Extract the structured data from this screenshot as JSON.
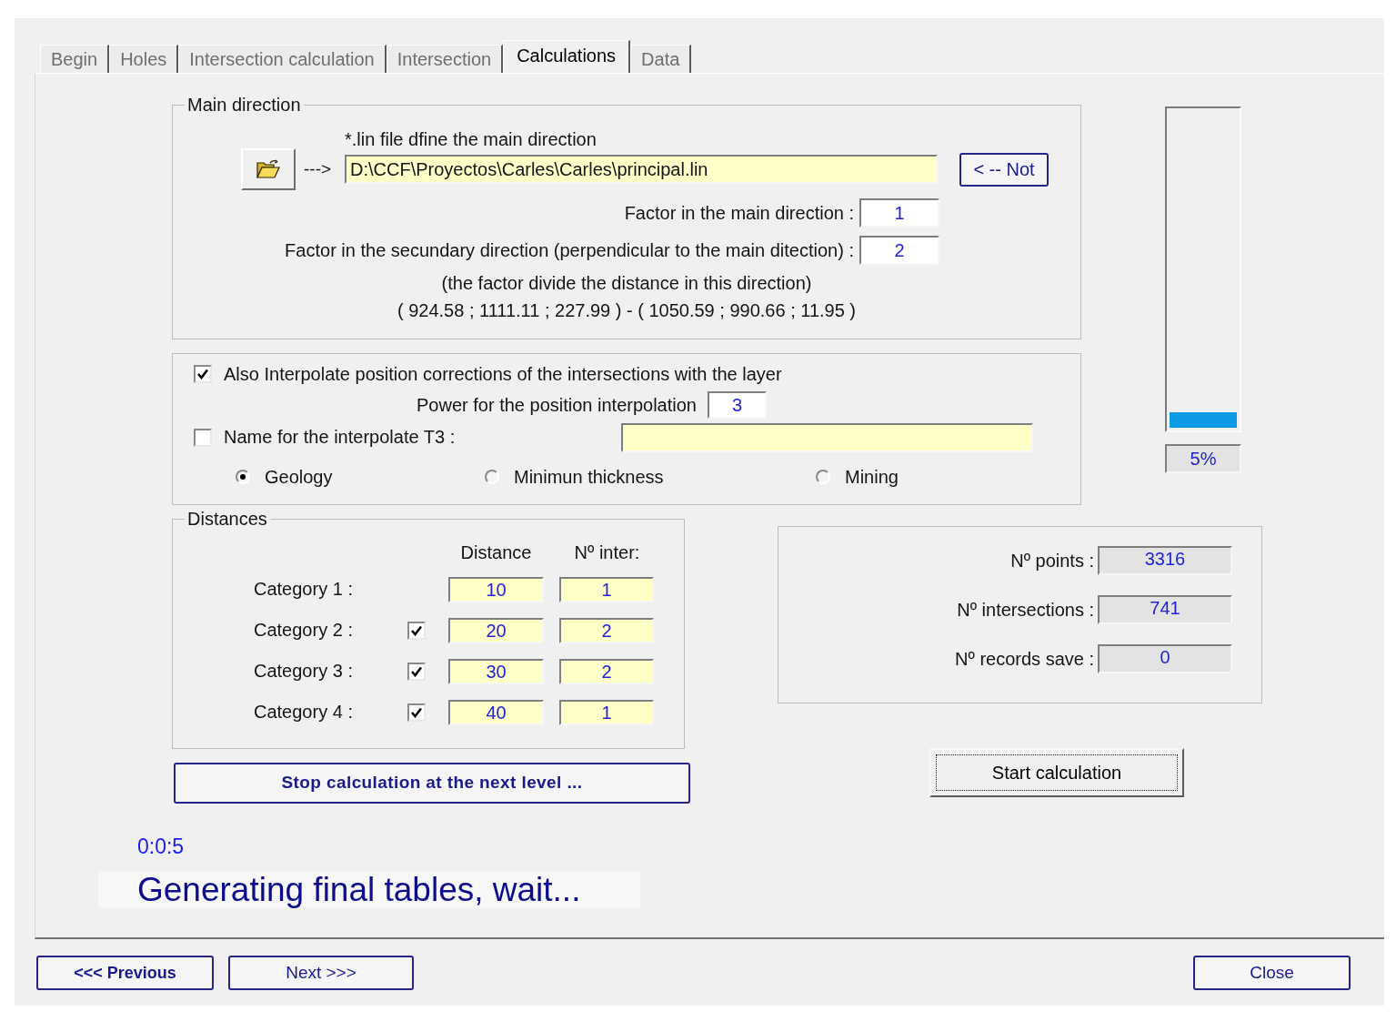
{
  "tabs": [
    {
      "label": "Begin",
      "selected": false
    },
    {
      "label": "Holes",
      "selected": false
    },
    {
      "label": "Intersection calculation",
      "selected": false
    },
    {
      "label": "Intersection",
      "selected": false
    },
    {
      "label": "Calculations",
      "selected": true
    },
    {
      "label": "Data",
      "selected": false
    }
  ],
  "main_direction": {
    "legend": "Main direction",
    "file_label": "*.lin file dfine the main direction",
    "arrow": "--->",
    "file_path": "D:\\CCF\\Proyectos\\Carles\\Carles\\principal.lin",
    "not_button": "< -- Not",
    "factors": [
      {
        "label": "Factor in the main direction :",
        "value": "1"
      },
      {
        "label": "Factor in the secundary direction (perpendicular to the main ditection) :",
        "value": "2"
      }
    ],
    "note": "(the factor divide the distance in this direction)",
    "coordinates": "( 924.58 ; 1111.11 ; 227.99 ) - ( 1050.59 ; 990.66 ; 11.95 )"
  },
  "interpolation": {
    "also_interpolate": {
      "label": "Also Interpolate position corrections of the intersections with the layer",
      "checked": true
    },
    "power": {
      "label": "Power for the position interpolation",
      "value": "3"
    },
    "t3_name": {
      "label": "Name for the interpolate T3 :",
      "checked": false
    },
    "modes": [
      {
        "label": "Geology",
        "selected": true
      },
      {
        "label": "Minimun thickness",
        "selected": false
      },
      {
        "label": "Mining",
        "selected": false
      }
    ]
  },
  "distances": {
    "legend": "Distances",
    "columns": [
      "Distance",
      "Nº inter:"
    ],
    "rows": [
      {
        "kind": "fixed",
        "label": "Category 1 :",
        "distance": "10",
        "intersections": "1"
      },
      {
        "kind": "optional",
        "label": "Category 2 :",
        "checked": true,
        "distance": "20",
        "intersections": "2"
      },
      {
        "kind": "optional",
        "label": "Category 3 :",
        "checked": true,
        "distance": "30",
        "intersections": "2"
      },
      {
        "kind": "optional",
        "label": "Category 4 :",
        "checked": true,
        "distance": "40",
        "intersections": "1"
      }
    ]
  },
  "stop_button": "Stop calculation at the next level ...",
  "progress": {
    "level": 0.05,
    "reading": "5%"
  },
  "stats": [
    {
      "label": "Nº points :",
      "value": "3316"
    },
    {
      "label": "Nº intersections :",
      "value": "741"
    },
    {
      "label": "Nº records save :",
      "value": "0"
    }
  ],
  "start_button": "Start calculation",
  "elapsed": "0:0:5",
  "status": "Generating final tables, wait...",
  "nav_buttons": [
    {
      "label": "<<< Previous",
      "default": true
    },
    {
      "label": "Next >>>",
      "default": false
    }
  ],
  "close_button": "Close"
}
